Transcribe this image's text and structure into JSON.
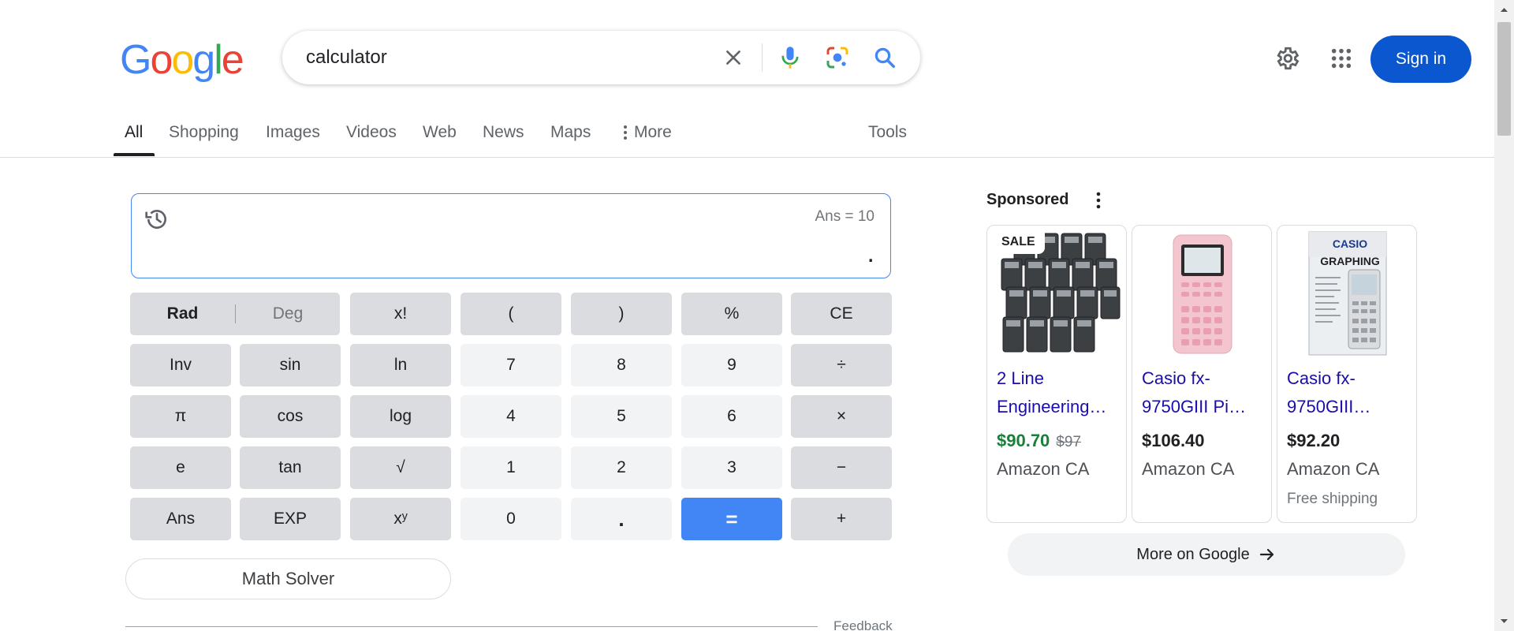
{
  "logo": {
    "letters": [
      "G",
      "o",
      "o",
      "g",
      "l",
      "e"
    ]
  },
  "search": {
    "query": "calculator"
  },
  "header": {
    "sign_in": "Sign in"
  },
  "tabs": [
    {
      "label": "All",
      "active": true
    },
    {
      "label": "Shopping"
    },
    {
      "label": "Images"
    },
    {
      "label": "Videos"
    },
    {
      "label": "Web"
    },
    {
      "label": "News"
    },
    {
      "label": "Maps"
    },
    {
      "label": "More"
    },
    {
      "label": "Tools"
    }
  ],
  "calculator": {
    "ans": "Ans = 10",
    "display": ".",
    "rad": "Rad",
    "deg": "Deg",
    "keys": {
      "fact": "x!",
      "lparen": "(",
      "rparen": ")",
      "percent": "%",
      "ce": "CE",
      "inv": "Inv",
      "sin": "sin",
      "ln": "ln",
      "seven": "7",
      "eight": "8",
      "nine": "9",
      "divide": "÷",
      "pi": "π",
      "cos": "cos",
      "log": "log",
      "four": "4",
      "five": "5",
      "six": "6",
      "multiply": "×",
      "e": "e",
      "tan": "tan",
      "sqrt": "√",
      "one": "1",
      "two": "2",
      "three": "3",
      "minus": "−",
      "ans": "Ans",
      "exp": "EXP",
      "pow": "xʸ",
      "zero": "0",
      "dot": ".",
      "equals": "=",
      "plus": "+"
    },
    "math_solver": "Math Solver",
    "feedback": "Feedback"
  },
  "sponsored": {
    "title": "Sponsored",
    "products": [
      {
        "badge": "SALE",
        "name": "2 Line Engineering…",
        "price": "$90.70",
        "old_price": "$97",
        "store": "Amazon CA"
      },
      {
        "name": "Casio fx-9750GIII Pi…",
        "price": "$106.40",
        "store": "Amazon CA"
      },
      {
        "name": "Casio fx-9750GIII…",
        "price": "$92.20",
        "store": "Amazon CA",
        "shipping": "Free shipping"
      }
    ],
    "product3_box_text": [
      "CASIO",
      "GRAPHING"
    ],
    "more_label": "More on Google"
  },
  "colors": {
    "accent": "#4285f4",
    "sign_in_bg": "#0b57d0",
    "link": "#1a0dab",
    "sale_price": "#188038"
  }
}
